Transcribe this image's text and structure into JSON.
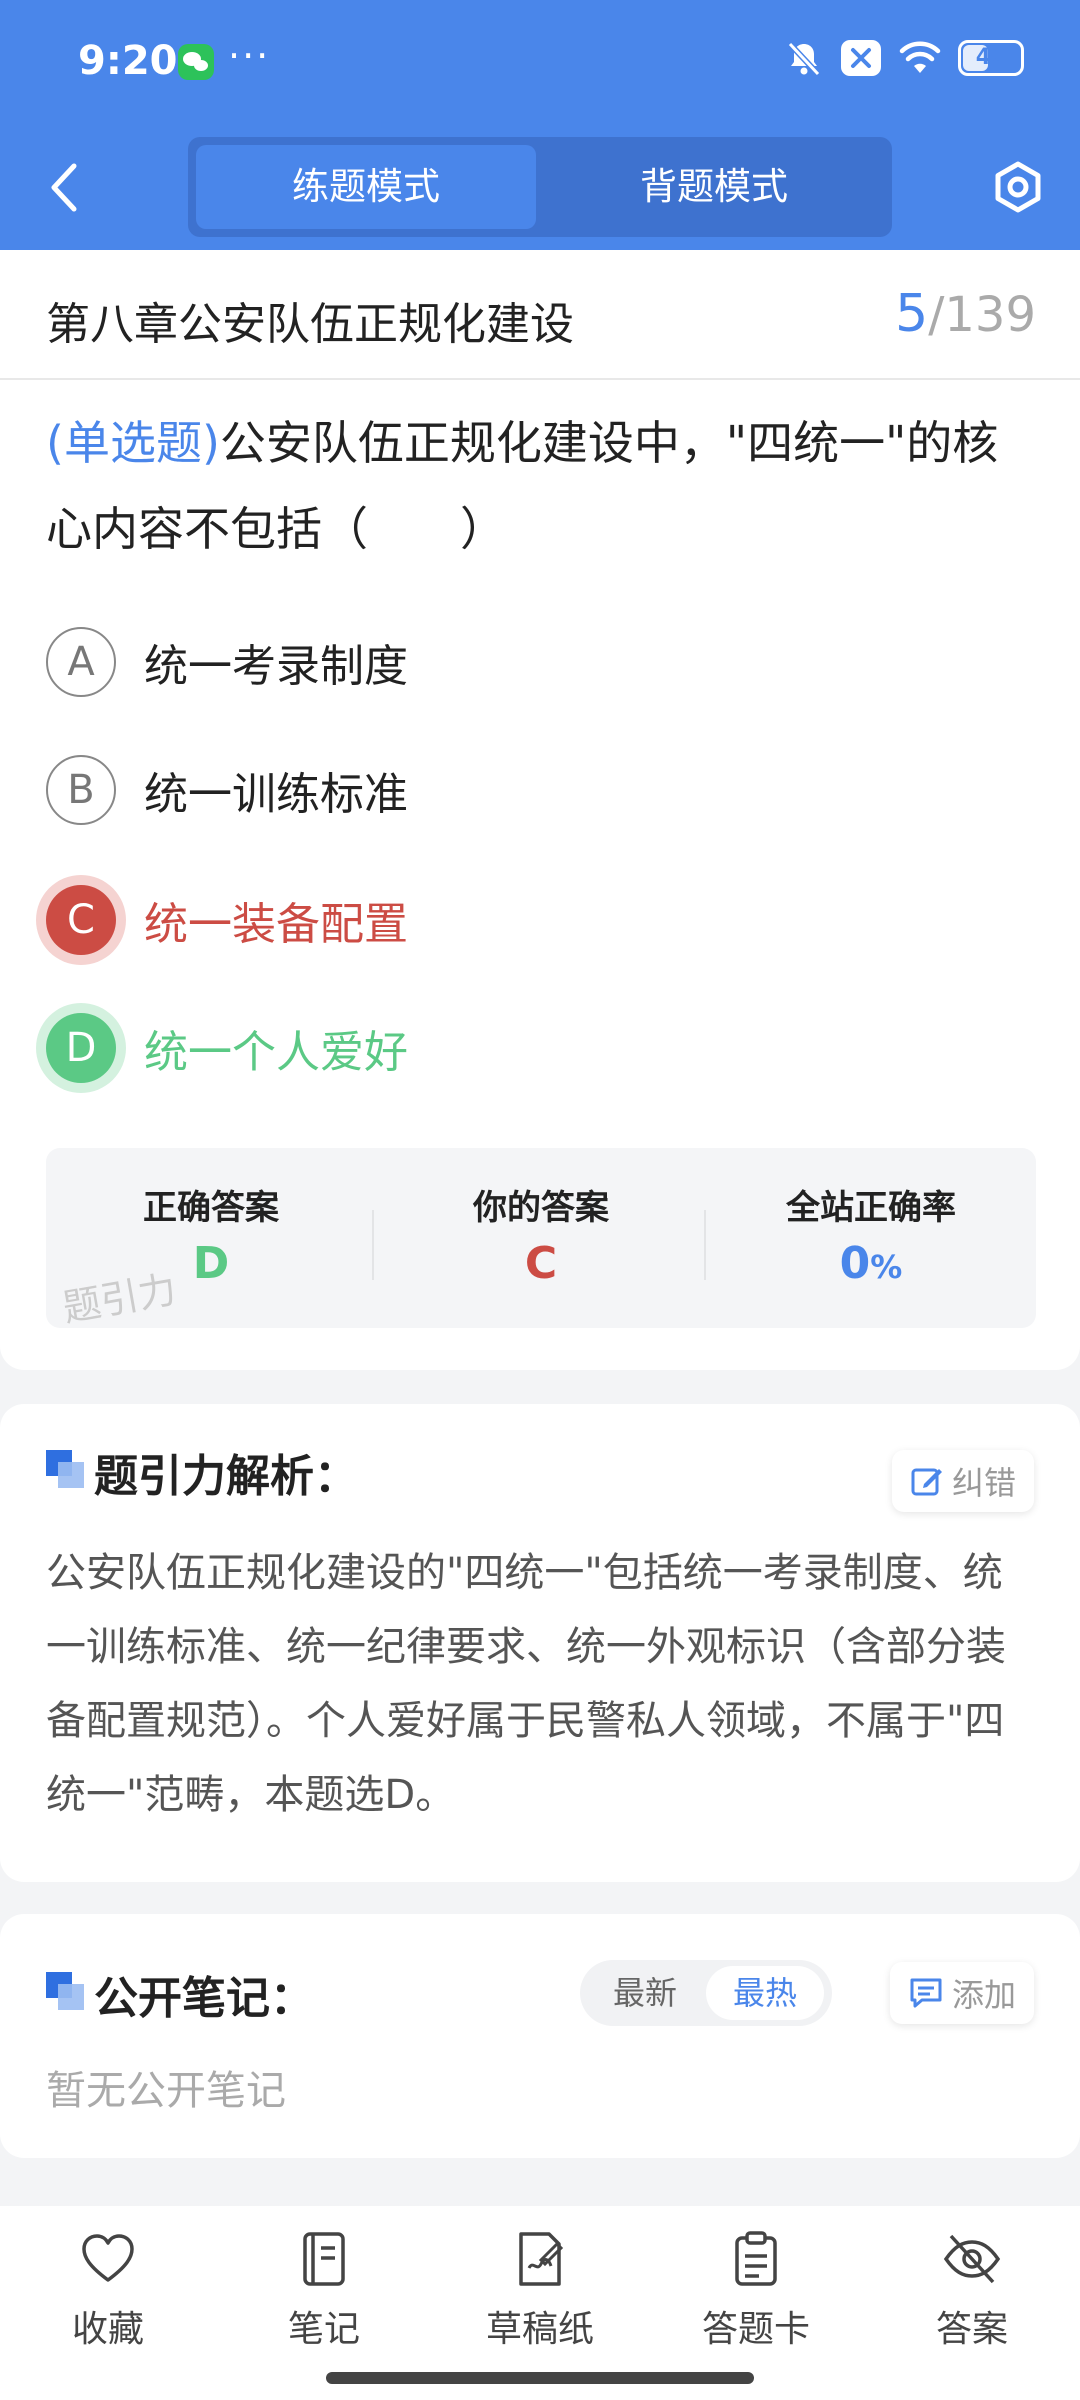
{
  "status": {
    "time": "9:20",
    "more": "···",
    "battery": "42",
    "icons": [
      "wechat-icon",
      "bell-off-icon",
      "close-box-icon",
      "wifi-icon",
      "battery-icon"
    ]
  },
  "nav": {
    "tabs": [
      "练题模式",
      "背题模式"
    ],
    "active_tab": "练题模式",
    "icons": [
      "back-icon",
      "settings-icon"
    ]
  },
  "question": {
    "chapter": "第八章公安队伍正规化建设",
    "current": "5",
    "total": "/139",
    "type": "(单选题)",
    "text": "公安队伍正规化建设中，\"四统一\"的核心内容不包括（　　）",
    "options": [
      {
        "letter": "A",
        "text": "统一考录制度",
        "state": "normal"
      },
      {
        "letter": "B",
        "text": "统一训练标准",
        "state": "normal"
      },
      {
        "letter": "C",
        "text": "统一装备配置",
        "state": "wrong"
      },
      {
        "letter": "D",
        "text": "统一个人爱好",
        "state": "correct"
      }
    ]
  },
  "answer": {
    "correct_label": "正确答案",
    "correct_value": "D",
    "yours_label": "你的答案",
    "yours_value": "C",
    "rate_label": "全站正确率",
    "rate_value": "0",
    "rate_unit": "%",
    "watermark": "题引力"
  },
  "analysis": {
    "title": "题引力解析：",
    "fix_button": "纠错",
    "text": "公安队伍正规化建设的\"四统一\"包括统一考录制度、统一训练标准、统一纪律要求、统一外观标识（含部分装备配置规范）。个人爱好属于民警私人领域，不属于\"四统一\"范畴，本题选D。"
  },
  "notes": {
    "title": "公开笔记：",
    "sort_options": [
      "最新",
      "最热"
    ],
    "active_sort": "最热",
    "add_button": "添加",
    "empty": "暂无公开笔记"
  },
  "bottom_tabs": [
    {
      "label": "收藏",
      "icon": "heart-icon"
    },
    {
      "label": "笔记",
      "icon": "notebook-icon"
    },
    {
      "label": "草稿纸",
      "icon": "draft-icon"
    },
    {
      "label": "答题卡",
      "icon": "clipboard-icon"
    },
    {
      "label": "答案",
      "icon": "eye-off-icon"
    }
  ],
  "colors": {
    "primary": "#4a86ea",
    "wrong": "#cc4c44",
    "correct": "#5bc985"
  }
}
